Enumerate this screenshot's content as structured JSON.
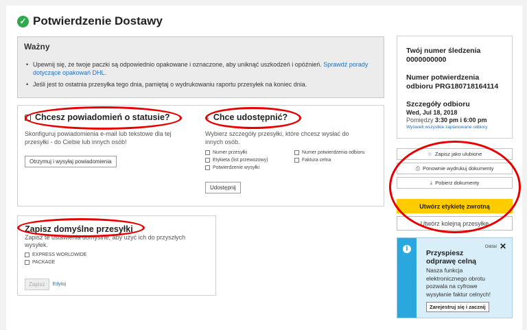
{
  "header": {
    "title": "Potwierdzenie Dostawy"
  },
  "important": {
    "heading": "Ważny",
    "bullet1_text": "Upewnij się, że twoje paczki są odpowiednio opakowane i oznaczone, aby uniknąć uszkodzeń i opóźnień.",
    "bullet1_link": "Sprawdź porady dotyczące opakowań DHL.",
    "bullet2_text": "Jeśli jest to ostatnia przesyłka tego dnia, pamiętaj o wydrukowaniu raportu przesyłek na koniec dnia."
  },
  "notifications": {
    "heading": "Chcesz powiadomień o statusie?",
    "description": "Skonfiguruj powiadomienia e-mail lub tekstowe dla tej przesyłki - do Ciebie lub innych osób!",
    "button": "Otrzymuj i wysyłaj powiadomienia"
  },
  "share": {
    "heading": "Chce udostępnić?",
    "description": "Wybierz szczegóły przesyłki, które chcesz wysłać do innych osób.",
    "options": [
      "Numer przesyłki",
      "Numer potwierdzenia odbioru",
      "Etykieta (list przewozowy)",
      "Faktura celna",
      "Potwierdzenie wysyłki"
    ],
    "button": "Udostępnij"
  },
  "defaults": {
    "heading": "Zapisz domyślne przesyłki",
    "description": "Zapisz te ustawienia domyślne, aby użyć ich do przyszłych wysyłek.",
    "options": [
      "EXPRESS WORLDWIDE",
      "PACKAGE"
    ],
    "save_button": "Zapisz",
    "edit_link": "Edytuj"
  },
  "tracking": {
    "tracking_label": "Twój numer śledzenia",
    "tracking_number": "0000000000",
    "pickup_label": "Numer potwierdzenia odbioru PRG180718164114",
    "pickup_details_label": "Szczegóły odbioru",
    "pickup_date": "Wed, Jul 18, 2018",
    "pickup_time_prefix": "Pomiędzy",
    "pickup_time": "3:30 pm i 6:00 pm",
    "all_pickups_link": "Wyświetl wszystkie zaplanowane odbiory"
  },
  "actions": {
    "favorite": "Zapisz jako ulubione",
    "reprint": "Ponownie wydrukuj dokumenty",
    "download": "Pobierz dokumenty",
    "return_label": "Utwórz etykietę zwrotną",
    "another_shipment": "Utwórz kolejną przesyłkę"
  },
  "promo": {
    "dismiss": "Oddal",
    "title": "Przyspiesz odprawę celną",
    "body": "Nasza funkcja elektronicznego obrotu pozwala na cyfrowe wysyłanie faktur celnych!",
    "button": "Zarejestruj się i zacznij"
  },
  "colors": {
    "accent_yellow": "#ffcc00",
    "annotation_red": "#e60000",
    "success_green": "#2eaa4a",
    "info_blue": "#2aa8dd"
  }
}
